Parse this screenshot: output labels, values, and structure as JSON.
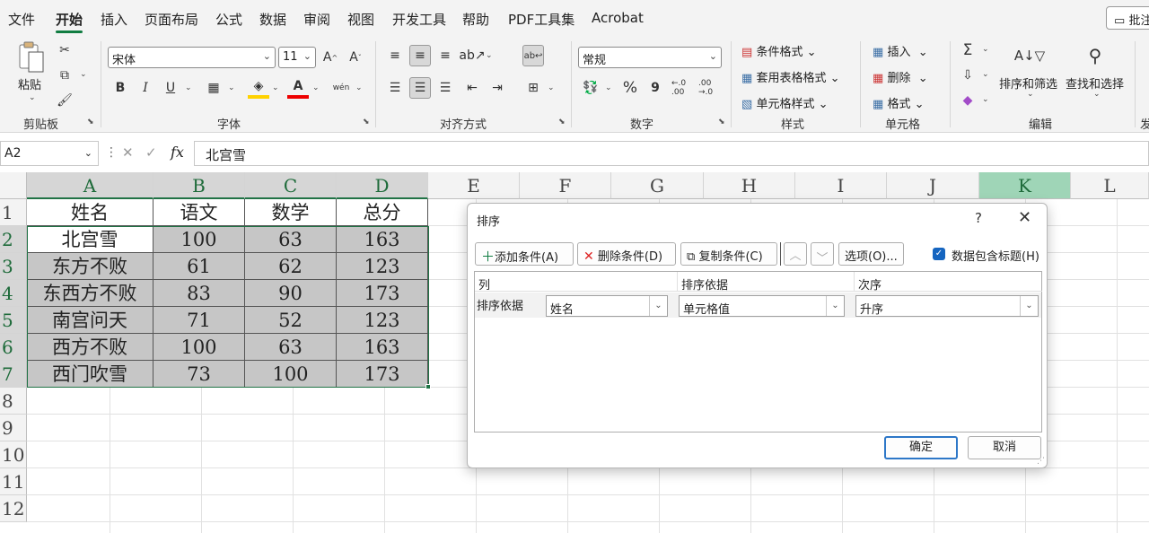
{
  "menu": {
    "items": [
      "文件",
      "开始",
      "插入",
      "页面布局",
      "公式",
      "数据",
      "审阅",
      "视图",
      "开发工具",
      "帮助",
      "PDF工具集",
      "Acrobat"
    ],
    "comment_label": "批注"
  },
  "ribbon": {
    "clipboard": {
      "paste_label": "粘贴",
      "group_label": "剪贴板"
    },
    "font": {
      "font_name": "宋体",
      "font_size": "11",
      "bold": "B",
      "italic": "I",
      "underline": "U",
      "grow": "A^",
      "shrink": "Aˇ",
      "group_label": "字体"
    },
    "alignment": {
      "group_label": "对齐方式"
    },
    "number": {
      "format": "常规",
      "percent": "%",
      "comma": "9",
      "inc_decimal": "←.0 .00",
      "dec_decimal": ".00 →.0",
      "group_label": "数字"
    },
    "styles": {
      "conditional": "条件格式",
      "table_format": "套用表格格式",
      "cell_styles": "单元格样式",
      "group_label": "样式"
    },
    "cells": {
      "insert": "插入",
      "delete": "删除",
      "format": "格式",
      "group_label": "单元格"
    },
    "editing": {
      "sort_filter": "排序和筛选",
      "find_select": "查找和选择",
      "group_label": "编辑",
      "next_label": "发"
    }
  },
  "formula_bar": {
    "name_box": "A2",
    "formula": "北宫雪",
    "fx": "fx"
  },
  "sheet": {
    "columns": [
      "A",
      "B",
      "C",
      "D",
      "E",
      "F",
      "G",
      "H",
      "I",
      "J",
      "K",
      "L"
    ],
    "rows": [
      "1",
      "2",
      "3",
      "4",
      "5",
      "6",
      "7",
      "8",
      "9",
      "10",
      "11",
      "12"
    ],
    "data": [
      [
        "姓名",
        "语文",
        "数学",
        "总分"
      ],
      [
        "北宫雪",
        "100",
        "63",
        "163"
      ],
      [
        "东方不败",
        "61",
        "62",
        "123"
      ],
      [
        "东西方不败",
        "83",
        "90",
        "173"
      ],
      [
        "南宫问天",
        "71",
        "52",
        "123"
      ],
      [
        "西方不败",
        "100",
        "63",
        "163"
      ],
      [
        "西门吹雪",
        "73",
        "100",
        "173"
      ]
    ]
  },
  "dialog": {
    "title": "排序",
    "help": "?",
    "close": "✕",
    "add_condition": "添加条件(A)",
    "delete_condition": "删除条件(D)",
    "copy_condition": "复制条件(C)",
    "options": "选项(O)...",
    "has_headers_label": "数据包含标题(H)",
    "headers": {
      "column": "列",
      "sort_on": "排序依据",
      "order": "次序"
    },
    "row_label": "排序依据",
    "column_value": "姓名",
    "sort_on_value": "单元格值",
    "order_value": "升序",
    "ok": "确定",
    "cancel": "取消"
  },
  "colors": {
    "accent": "#107c41",
    "selection_border": "#217346",
    "ok_border": "#2e78c8"
  }
}
